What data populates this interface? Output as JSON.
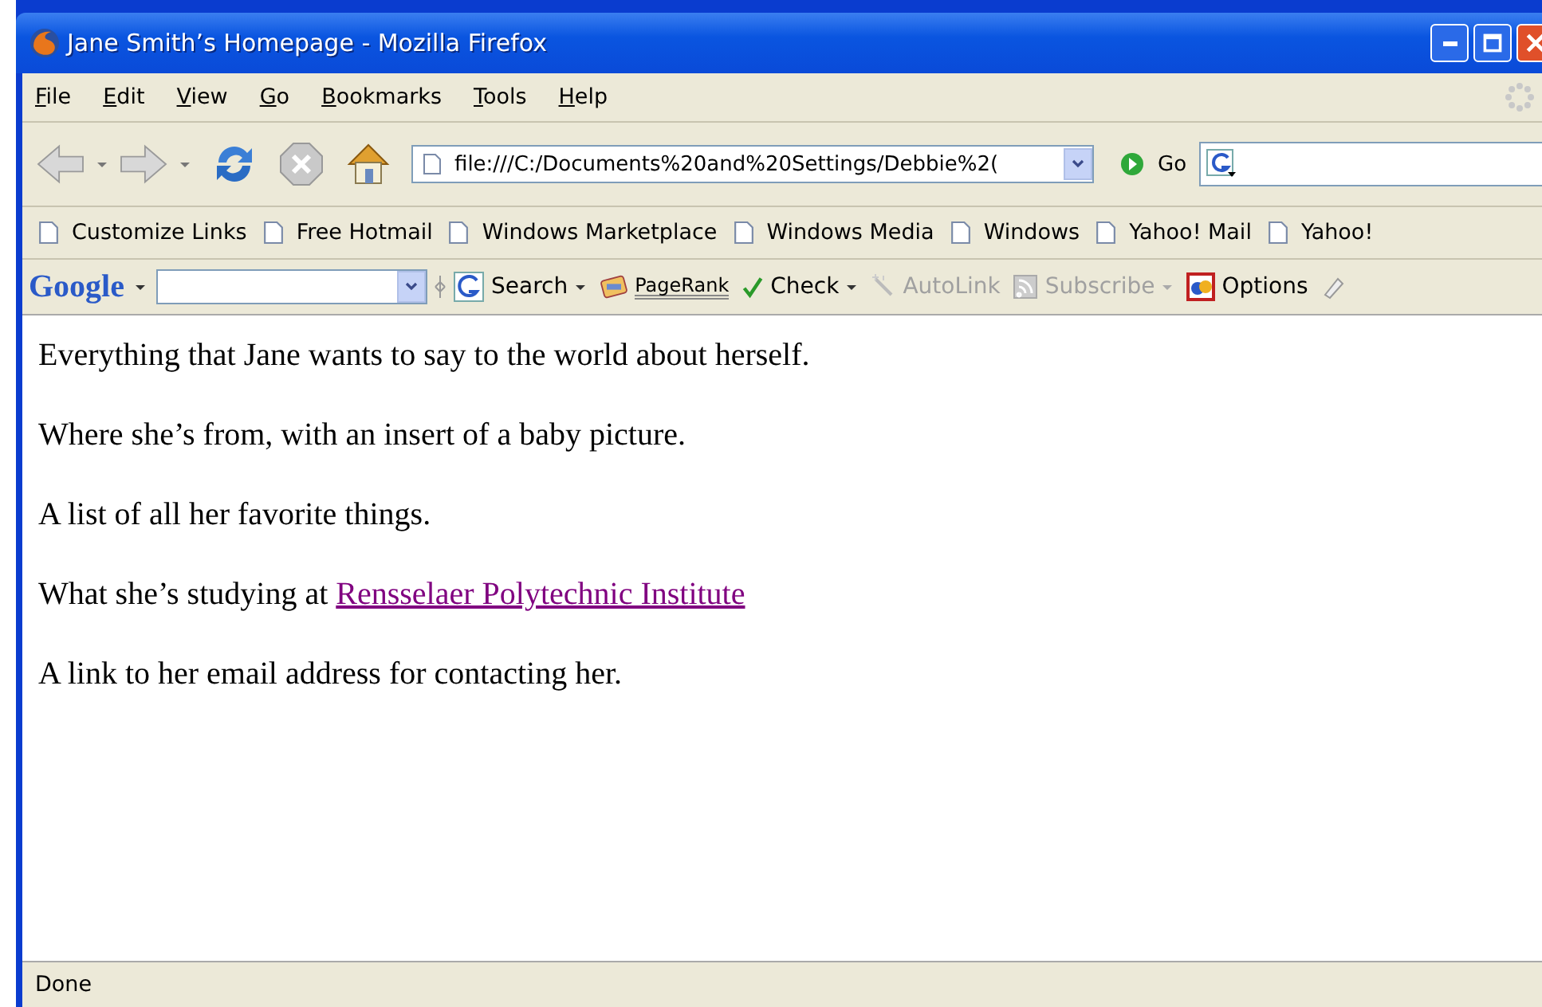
{
  "window": {
    "title": "Jane Smith’s Homepage - Mozilla Firefox"
  },
  "menu": [
    "File",
    "Edit",
    "View",
    "Go",
    "Bookmarks",
    "Tools",
    "Help"
  ],
  "navigation": {
    "address": "file:///C:/Documents%20and%20Settings/Debbie%2(",
    "go": "Go"
  },
  "bookmarks": [
    "Customize Links",
    "Free Hotmail",
    "Windows Marketplace",
    "Windows Media",
    "Windows",
    "Yahoo! Mail",
    "Yahoo!"
  ],
  "google_toolbar": {
    "logo": "Google",
    "items": [
      {
        "kind": "search",
        "label": "Search",
        "disabled": false,
        "dropdown": true
      },
      {
        "kind": "pagerank",
        "label": "PageRank",
        "disabled": false,
        "dropdown": false
      },
      {
        "kind": "check",
        "label": "Check",
        "disabled": false,
        "dropdown": true
      },
      {
        "kind": "autolink",
        "label": "AutoLink",
        "disabled": true,
        "dropdown": false
      },
      {
        "kind": "subscribe",
        "label": "Subscribe",
        "disabled": true,
        "dropdown": true
      },
      {
        "kind": "options",
        "label": "Options",
        "disabled": false,
        "dropdown": false
      }
    ]
  },
  "content": [
    [
      {
        "text": "Everything that Jane wants to say to the world about herself.",
        "link": false
      }
    ],
    [
      {
        "text": "Where she’s from, with an insert of a baby picture.",
        "link": false
      }
    ],
    [
      {
        "text": "A list of all her favorite things.",
        "link": false
      }
    ],
    [
      {
        "text": "What she’s studying at ",
        "link": false
      },
      {
        "text": "Rensselaer Polytechnic Institute",
        "link": true,
        "visited": true
      }
    ],
    [
      {
        "text": "A link to her email address for contacting her.",
        "link": false
      }
    ]
  ],
  "status_bar": "Done"
}
